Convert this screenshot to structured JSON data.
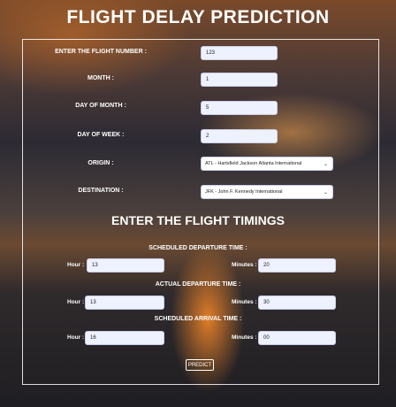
{
  "title": "FLIGHT DELAY PREDICTION",
  "flight_number": {
    "label": "ENTER THE FLIGHT NUMBER :",
    "value": "123"
  },
  "month": {
    "label": "MONTH :",
    "value": "1"
  },
  "day_of_month": {
    "label": "DAY OF MONTH :",
    "value": "5"
  },
  "day_of_week": {
    "label": "DAY OF WEEK :",
    "value": "2"
  },
  "origin": {
    "label": "ORIGIN :",
    "value": "ATL - Hartsfield Jackson Atlanta International"
  },
  "destination": {
    "label": "DESTINATION :",
    "value": "JFK - John F. Kennedy International"
  },
  "timings_heading": "ENTER THE FLIGHT TIMINGS",
  "scheduled_departure": {
    "heading": "SCHEDULED DEPARTURE TIME :",
    "hour_label": "Hour :",
    "hour": "13",
    "minutes_label": "Minutes :",
    "minutes": "20"
  },
  "actual_departure": {
    "heading": "ACTUAL DEPARTURE TIME :",
    "hour_label": "Hour :",
    "hour": "13",
    "minutes_label": "Minutes :",
    "minutes": "30"
  },
  "scheduled_arrival": {
    "heading": "SCHEDULED ARRIVAL TIME :",
    "hour_label": "Hour :",
    "hour": "16",
    "minutes_label": "Minutes :",
    "minutes": "00"
  },
  "predict_label": "PREDICT"
}
